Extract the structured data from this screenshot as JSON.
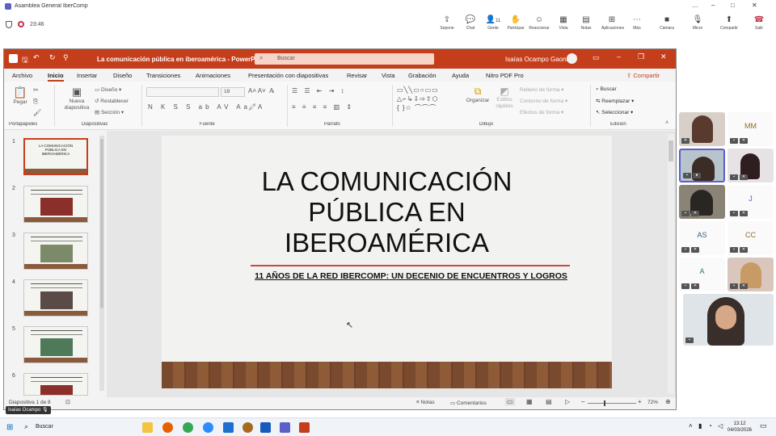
{
  "teams": {
    "window_title": "Asamblea General IberComp",
    "timer": "23:46",
    "participants_count": "11",
    "buttons": [
      {
        "label": "Sepone",
        "icon": "share-icon"
      },
      {
        "label": "Chat",
        "icon": "chat-icon"
      },
      {
        "label": "Gente",
        "icon": "people-icon"
      },
      {
        "label": "Participar",
        "icon": "raise-hand-icon"
      },
      {
        "label": "Reaccionar",
        "icon": "smiley-icon"
      },
      {
        "label": "Vista",
        "icon": "grid-icon"
      },
      {
        "label": "Notas",
        "icon": "notes-icon"
      },
      {
        "label": "Aplicaciones",
        "icon": "apps-icon"
      },
      {
        "label": "Más",
        "icon": "more-icon"
      },
      {
        "label": "Cámara",
        "icon": "camera-icon"
      },
      {
        "label": "Micro",
        "icon": "mic-icon"
      },
      {
        "label": "Compartir",
        "icon": "share-screen-icon"
      },
      {
        "label": "Salir",
        "icon": "hangup-icon"
      }
    ],
    "window_controls": [
      "…",
      "–",
      "□",
      "✕"
    ]
  },
  "ppt": {
    "file_title": "La comunicación pública en iberoamérica  -  PowerPoint",
    "search_placeholder": "Buscar",
    "user": "Isaías Ocampo Gaona",
    "share": "Compartir",
    "tabs": [
      "Archivo",
      "Inicio",
      "Insertar",
      "Diseño",
      "Transiciones",
      "Animaciones",
      "Presentación con diapositivas",
      "Revisar",
      "Vista",
      "Grabación",
      "Ayuda",
      "Nitro PDF Pro"
    ],
    "active_tab": "Inicio",
    "ribbon": {
      "paste": "Pegar",
      "new_slide": "Nueva diapositiva",
      "layout": "Diseño",
      "reset": "Restablecer",
      "section": "Sección",
      "font_size": "18",
      "organize": "Organizar",
      "quick_styles": "Estilos rápidos",
      "shape_fill": "Relleno de forma",
      "shape_outline": "Contorno de forma",
      "shape_effects": "Efectos de forma",
      "find": "Buscar",
      "replace": "Reemplazar",
      "select": "Seleccionar",
      "groups": [
        "Portapapeles",
        "Diapositivas",
        "Fuente",
        "Párrafo",
        "Dibujo",
        "Edición"
      ]
    },
    "thumb_numbers": [
      "1",
      "2",
      "3",
      "4",
      "5",
      "6"
    ],
    "thumb1_title": "LA COMUNICACIÓN PÚBLICA EN IBEROAMÉRICA",
    "slide": {
      "title_lines": [
        "LA COMUNICACIÓN",
        "PÚBLICA EN",
        "IBEROAMÉRICA"
      ],
      "subtitle": "11 AÑOS DE LA RED IBERCOMP: UN DECENIO DE ENCUENTROS Y LOGROS"
    },
    "status": {
      "slide_count": "Diapositiva 1 de 8",
      "notes": "Notas",
      "comments": "Comentarios",
      "zoom": "72%"
    },
    "presenter_tag": "Isaías Ocampo"
  },
  "participants": [
    {
      "initials": ""
    },
    {
      "initials": "MM"
    },
    {
      "initials": ""
    },
    {
      "initials": ""
    },
    {
      "initials": ""
    },
    {
      "initials": "J"
    },
    {
      "initials": "AS"
    },
    {
      "initials": "CC"
    },
    {
      "initials": "A"
    },
    {
      "initials": ""
    }
  ],
  "taskbar": {
    "search": "Buscar",
    "time": "13:12",
    "date": "04/03/2026"
  }
}
